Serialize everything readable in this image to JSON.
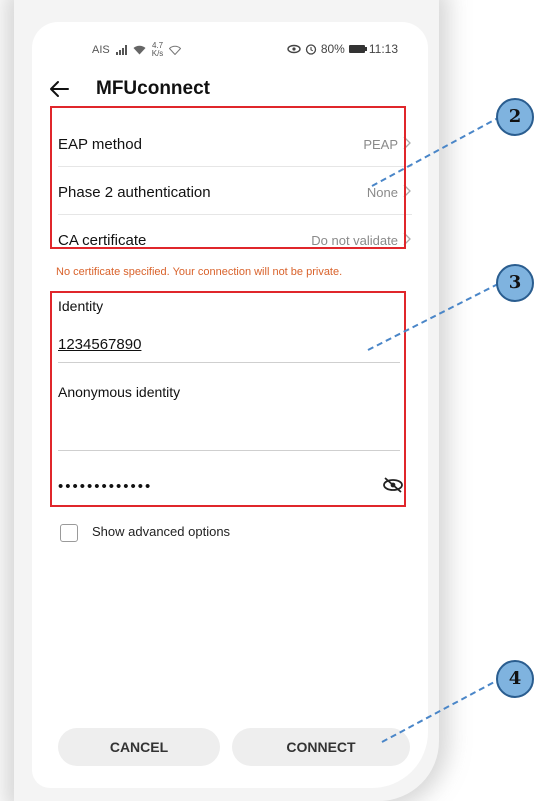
{
  "status_bar": {
    "carrier": "AIS",
    "speed_value": "4.7",
    "speed_unit": "K/s",
    "battery": "80%",
    "time": "11:13"
  },
  "header": {
    "title": "MFUconnect"
  },
  "settings": [
    {
      "label": "EAP method",
      "value": "PEAP"
    },
    {
      "label": "Phase 2 authentication",
      "value": "None"
    },
    {
      "label": "CA certificate",
      "value": "Do not validate"
    }
  ],
  "warning": "No certificate specified. Your connection will not be private.",
  "identity": {
    "label": "Identity",
    "value": "1234567890"
  },
  "anonymous_identity": {
    "label": "Anonymous identity"
  },
  "password": {
    "masked": "•••••••••••••"
  },
  "advanced": {
    "label": "Show advanced options",
    "checked": false
  },
  "buttons": {
    "cancel": "CANCEL",
    "connect": "CONNECT"
  },
  "callouts": [
    "2",
    "3",
    "4"
  ],
  "colors": {
    "highlight_box": "#e0262b",
    "callout_fill": "#7fb3df",
    "callout_border": "#2a5d8f",
    "warning": "#d9622b"
  }
}
